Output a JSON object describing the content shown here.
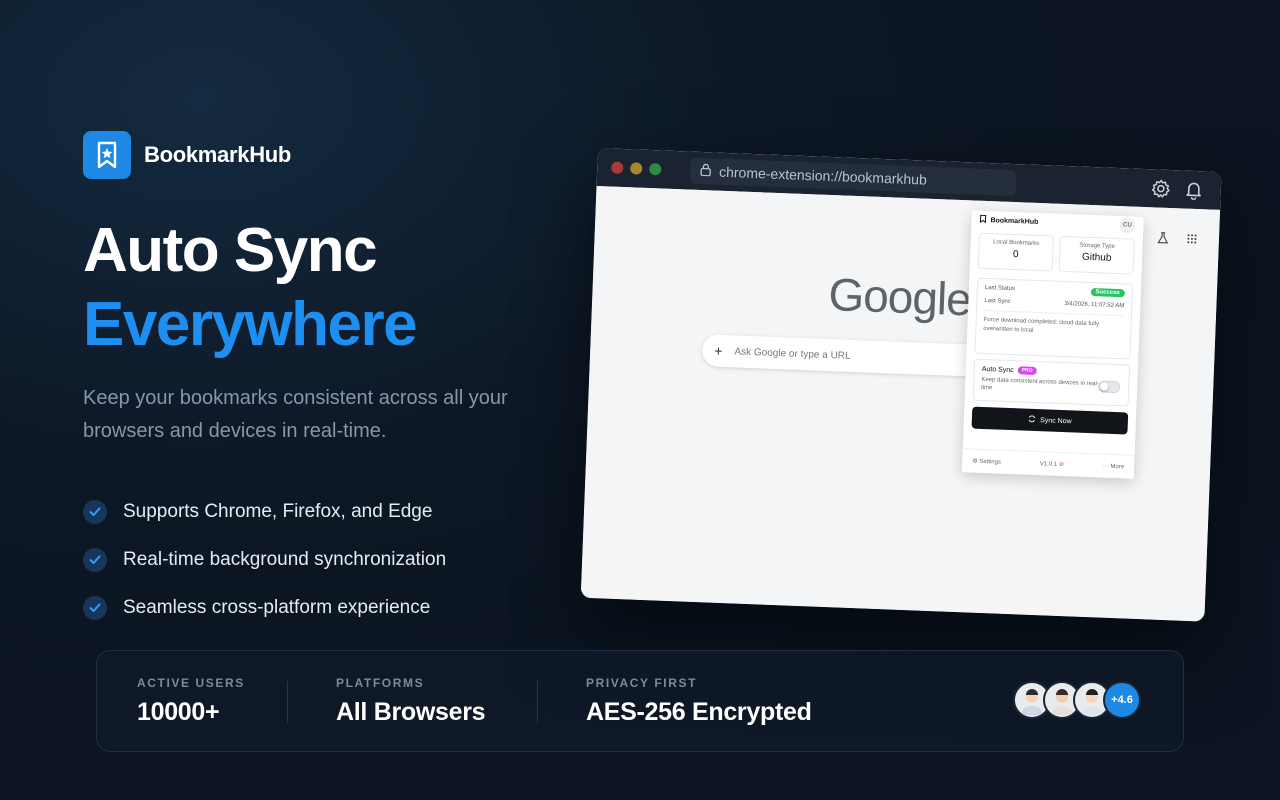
{
  "brand": {
    "name": "BookmarkHub"
  },
  "hero": {
    "headline_line1": "Auto Sync",
    "headline_line2": "Everywhere",
    "subtitle": "Keep your bookmarks consistent across all your browsers and devices in real-time."
  },
  "features": [
    "Supports Chrome, Firefox, and Edge",
    "Real-time background synchronization",
    "Seamless cross-platform experience"
  ],
  "browser": {
    "url": "chrome-extension://bookmarkhub",
    "google_logo": "Google",
    "search_placeholder": "Ask Google or type a URL",
    "popup": {
      "title": "BookmarkHub",
      "avatar": "CU",
      "local_bookmarks_label": "Local Bookmarks",
      "local_bookmarks_value": "0",
      "storage_type_label": "Storage Type",
      "storage_type_value": "Github",
      "last_status_label": "Last Status",
      "last_status_value": "Success",
      "last_sync_label": "Last Sync",
      "last_sync_value": "3/4/2026, 11:07:52 AM",
      "message": "Force download completed: cloud data fully overwritten to local",
      "auto_sync_label": "Auto Sync",
      "pro_badge": "PRO",
      "auto_sync_desc": "Keep data consistent across devices in real-time",
      "sync_now": "Sync Now",
      "settings": "Settings",
      "version": "V1.0.1",
      "more": "More"
    }
  },
  "stats": [
    {
      "label": "ACTIVE USERS",
      "value": "10000+"
    },
    {
      "label": "PLATFORMS",
      "value": "All Browsers"
    },
    {
      "label": "PRIVACY FIRST",
      "value": "AES-256 Encrypted"
    }
  ],
  "rating_badge": "+4.6",
  "colors": {
    "accent": "#1e8ef0",
    "success": "#22c55e",
    "pro": "#d946ef"
  }
}
